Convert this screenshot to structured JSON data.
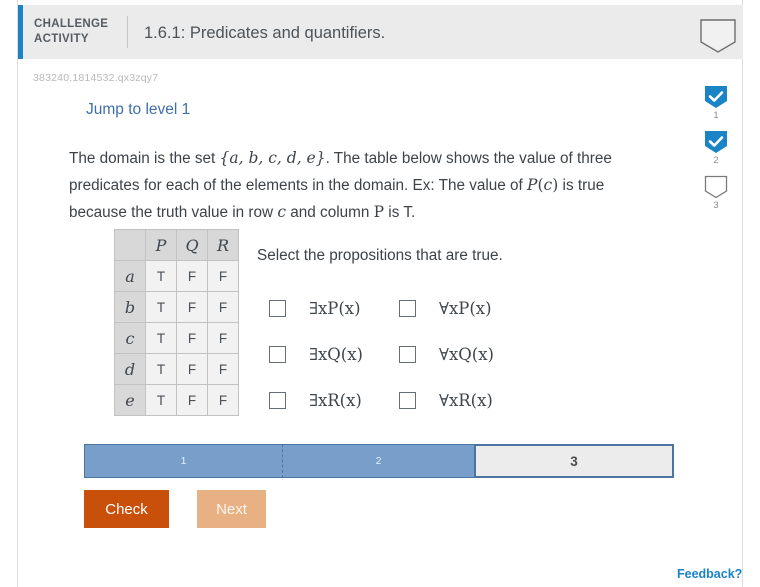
{
  "header": {
    "kicker_line1": "CHALLENGE",
    "kicker_line2": "ACTIVITY",
    "title": "1.6.1: Predicates and quantifiers.",
    "accent_color": "#1a84c7",
    "background": "#ebebeb"
  },
  "activity_id": "383240.1814532.qx3zqy7",
  "jump_link": "Jump to level 1",
  "prompt": {
    "part1": "The domain is the set ",
    "set": "{a, b, c, d, e}",
    "part2": ". The table below shows the value of three predicates for each of the elements in the domain. Ex: The value of ",
    "pc": "P(c)",
    "part3": " is true because the truth value in row ",
    "rowvar": "c",
    "part4": " and column ",
    "colvar": "P",
    "part5": " is T."
  },
  "truth_table": {
    "corner": "",
    "columns": [
      "P",
      "Q",
      "R"
    ],
    "rows": [
      {
        "label": "a",
        "values": [
          "T",
          "F",
          "F"
        ]
      },
      {
        "label": "b",
        "values": [
          "T",
          "F",
          "F"
        ]
      },
      {
        "label": "c",
        "values": [
          "T",
          "F",
          "F"
        ]
      },
      {
        "label": "d",
        "values": [
          "T",
          "F",
          "F"
        ]
      },
      {
        "label": "e",
        "values": [
          "T",
          "F",
          "F"
        ]
      }
    ]
  },
  "propositions": {
    "instruction": "Select the propositions that are true.",
    "options": [
      {
        "label": "∃xP(x)",
        "quantifier": "∃",
        "var": "x",
        "predicate": "P",
        "arg": "x",
        "checked": false
      },
      {
        "label": "∀xP(x)",
        "quantifier": "∀",
        "var": "x",
        "predicate": "P",
        "arg": "x",
        "checked": false
      },
      {
        "label": "∃xQ(x)",
        "quantifier": "∃",
        "var": "x",
        "predicate": "Q",
        "arg": "x",
        "checked": false
      },
      {
        "label": "∀xQ(x)",
        "quantifier": "∀",
        "var": "x",
        "predicate": "Q",
        "arg": "x",
        "checked": false
      },
      {
        "label": "∃xR(x)",
        "quantifier": "∃",
        "var": "x",
        "predicate": "R",
        "arg": "x",
        "checked": false
      },
      {
        "label": "∀xR(x)",
        "quantifier": "∀",
        "var": "x",
        "predicate": "R",
        "arg": "x",
        "checked": false
      }
    ]
  },
  "progress": {
    "segments": [
      {
        "label": "1",
        "state": "done"
      },
      {
        "label": "2",
        "state": "done"
      },
      {
        "label": "3",
        "state": "current"
      }
    ],
    "done_color": "#789fc9",
    "current_color": "#ececec",
    "border_color": "#4c74a0"
  },
  "buttons": {
    "check": "Check",
    "next": "Next",
    "check_color": "#c8500a",
    "next_color": "#e8b183"
  },
  "feedback_link": "Feedback?",
  "rail": {
    "items": [
      {
        "number": "1",
        "state": "complete"
      },
      {
        "number": "2",
        "state": "complete"
      },
      {
        "number": "3",
        "state": "incomplete"
      }
    ],
    "complete_color": "#1a84c7",
    "incomplete_border": "#7a7a7a"
  }
}
